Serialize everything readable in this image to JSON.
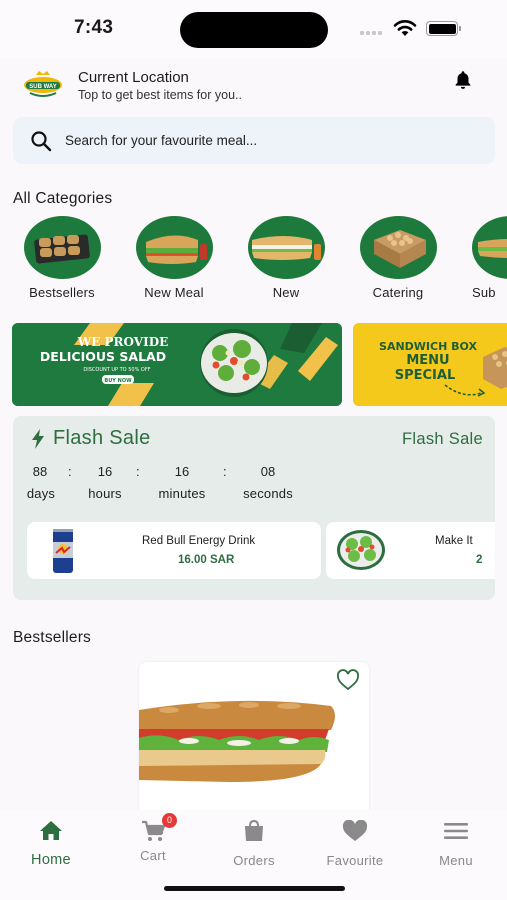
{
  "status_bar": {
    "time": "7:43"
  },
  "header": {
    "location_title": "Current Location",
    "location_subtitle": "Top to get best items for you..",
    "logo_text": "SUB WAY"
  },
  "search": {
    "placeholder": "Search for your favourite meal..."
  },
  "categories": {
    "title": "All Categories",
    "items": [
      {
        "label": "Bestsellers"
      },
      {
        "label": "New Meal"
      },
      {
        "label": "New"
      },
      {
        "label": "Catering"
      },
      {
        "label": "Sub"
      }
    ]
  },
  "banners": [
    {
      "line1": "WE PROVIDE",
      "line2": "DELICIOUS SALAD",
      "line3": "DISCOUNT UP TO 50% OFF",
      "button": "BUY NOW"
    },
    {
      "line1": "SANDWICH BOX",
      "line2": "MENU",
      "line3": "SPECIAL"
    }
  ],
  "flash_sale": {
    "title": "Flash Sale",
    "link": "Flash Sale",
    "countdown": [
      {
        "value": "88",
        "unit": "days"
      },
      {
        "value": "16",
        "unit": "hours"
      },
      {
        "value": "16",
        "unit": "minutes"
      },
      {
        "value": "08",
        "unit": "seconds"
      }
    ],
    "separator": ":",
    "products": [
      {
        "name": "Red Bull Energy Drink",
        "price": "16.00 SAR"
      },
      {
        "name": "Make It",
        "price": "2"
      }
    ]
  },
  "bestsellers": {
    "title": "Bestsellers"
  },
  "bottom_nav": {
    "items": [
      {
        "label": "Home",
        "icon": "home-icon",
        "active": true
      },
      {
        "label": "Cart",
        "icon": "cart-icon",
        "badge": "0"
      },
      {
        "label": "Orders",
        "icon": "bag-icon"
      },
      {
        "label": "Favourite",
        "icon": "heart-icon"
      },
      {
        "label": "Menu",
        "icon": "menu-icon"
      }
    ]
  },
  "colors": {
    "brand_green": "#2d6e40",
    "banner_green": "#1f7a3f",
    "banner_yellow": "#f5c81c",
    "badge_red": "#e53935"
  }
}
